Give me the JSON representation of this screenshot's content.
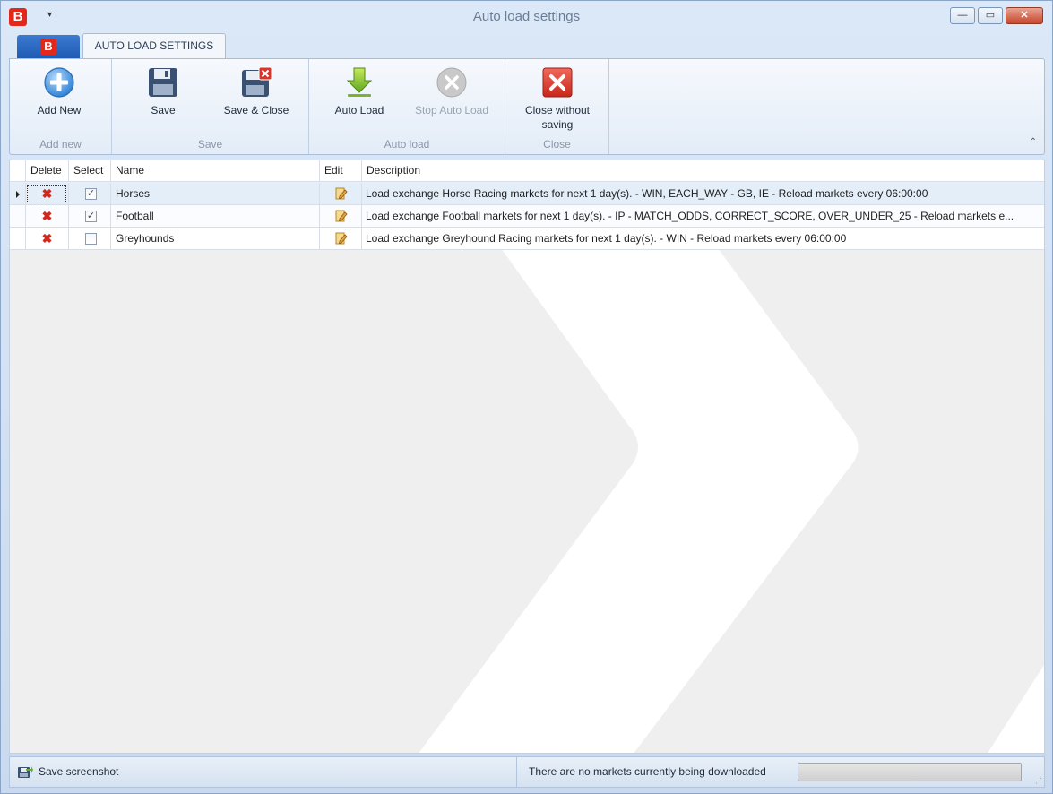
{
  "window": {
    "title": "Auto load settings",
    "app_logo": "B",
    "qat_arrow": "▾",
    "minimize": "—",
    "maximize": "▭",
    "close": "✕"
  },
  "tabs": {
    "file_logo": "B",
    "active_tab": "AUTO LOAD SETTINGS"
  },
  "ribbon": {
    "groups": [
      {
        "label": "Add new",
        "buttons": [
          {
            "label": "Add New",
            "icon": "add-circle-icon"
          }
        ]
      },
      {
        "label": "Save",
        "buttons": [
          {
            "label": "Save",
            "icon": "floppy-disk-icon"
          },
          {
            "label": "Save & Close",
            "icon": "floppy-disk-close-icon"
          }
        ]
      },
      {
        "label": "Auto load",
        "buttons": [
          {
            "label": "Auto Load",
            "icon": "download-arrow-icon"
          },
          {
            "label": "Stop Auto Load",
            "icon": "stop-circle-icon",
            "disabled": true
          }
        ]
      },
      {
        "label": "Close",
        "buttons": [
          {
            "label": "Close without saving",
            "label_line1": "Close without",
            "label_line2": "saving",
            "icon": "close-red-icon"
          }
        ]
      }
    ],
    "collapse_glyph": "⌃"
  },
  "grid": {
    "columns": [
      "Delete",
      "Select",
      "Name",
      "Edit",
      "Description"
    ],
    "rows": [
      {
        "delete": "✖",
        "selected": true,
        "check": "✓",
        "name": "Horses",
        "description": "Load  exchange Horse Racing markets for next 1 day(s). - WIN, EACH_WAY - GB, IE - Reload markets every 06:00:00"
      },
      {
        "delete": "✖",
        "selected": true,
        "check": "✓",
        "name": "Football",
        "description": "Load  exchange Football markets for next 1 day(s). - IP - MATCH_ODDS, CORRECT_SCORE, OVER_UNDER_25 - Reload markets e..."
      },
      {
        "delete": "✖",
        "selected": false,
        "check": "",
        "name": "Greyhounds",
        "description": "Load  exchange Greyhound Racing markets for next 1 day(s). - WIN - Reload markets every 06:00:00"
      }
    ]
  },
  "statusbar": {
    "save_screenshot": "Save screenshot",
    "status_message": "There are no markets currently being downloaded",
    "progress": 0,
    "grip": "⋰"
  }
}
